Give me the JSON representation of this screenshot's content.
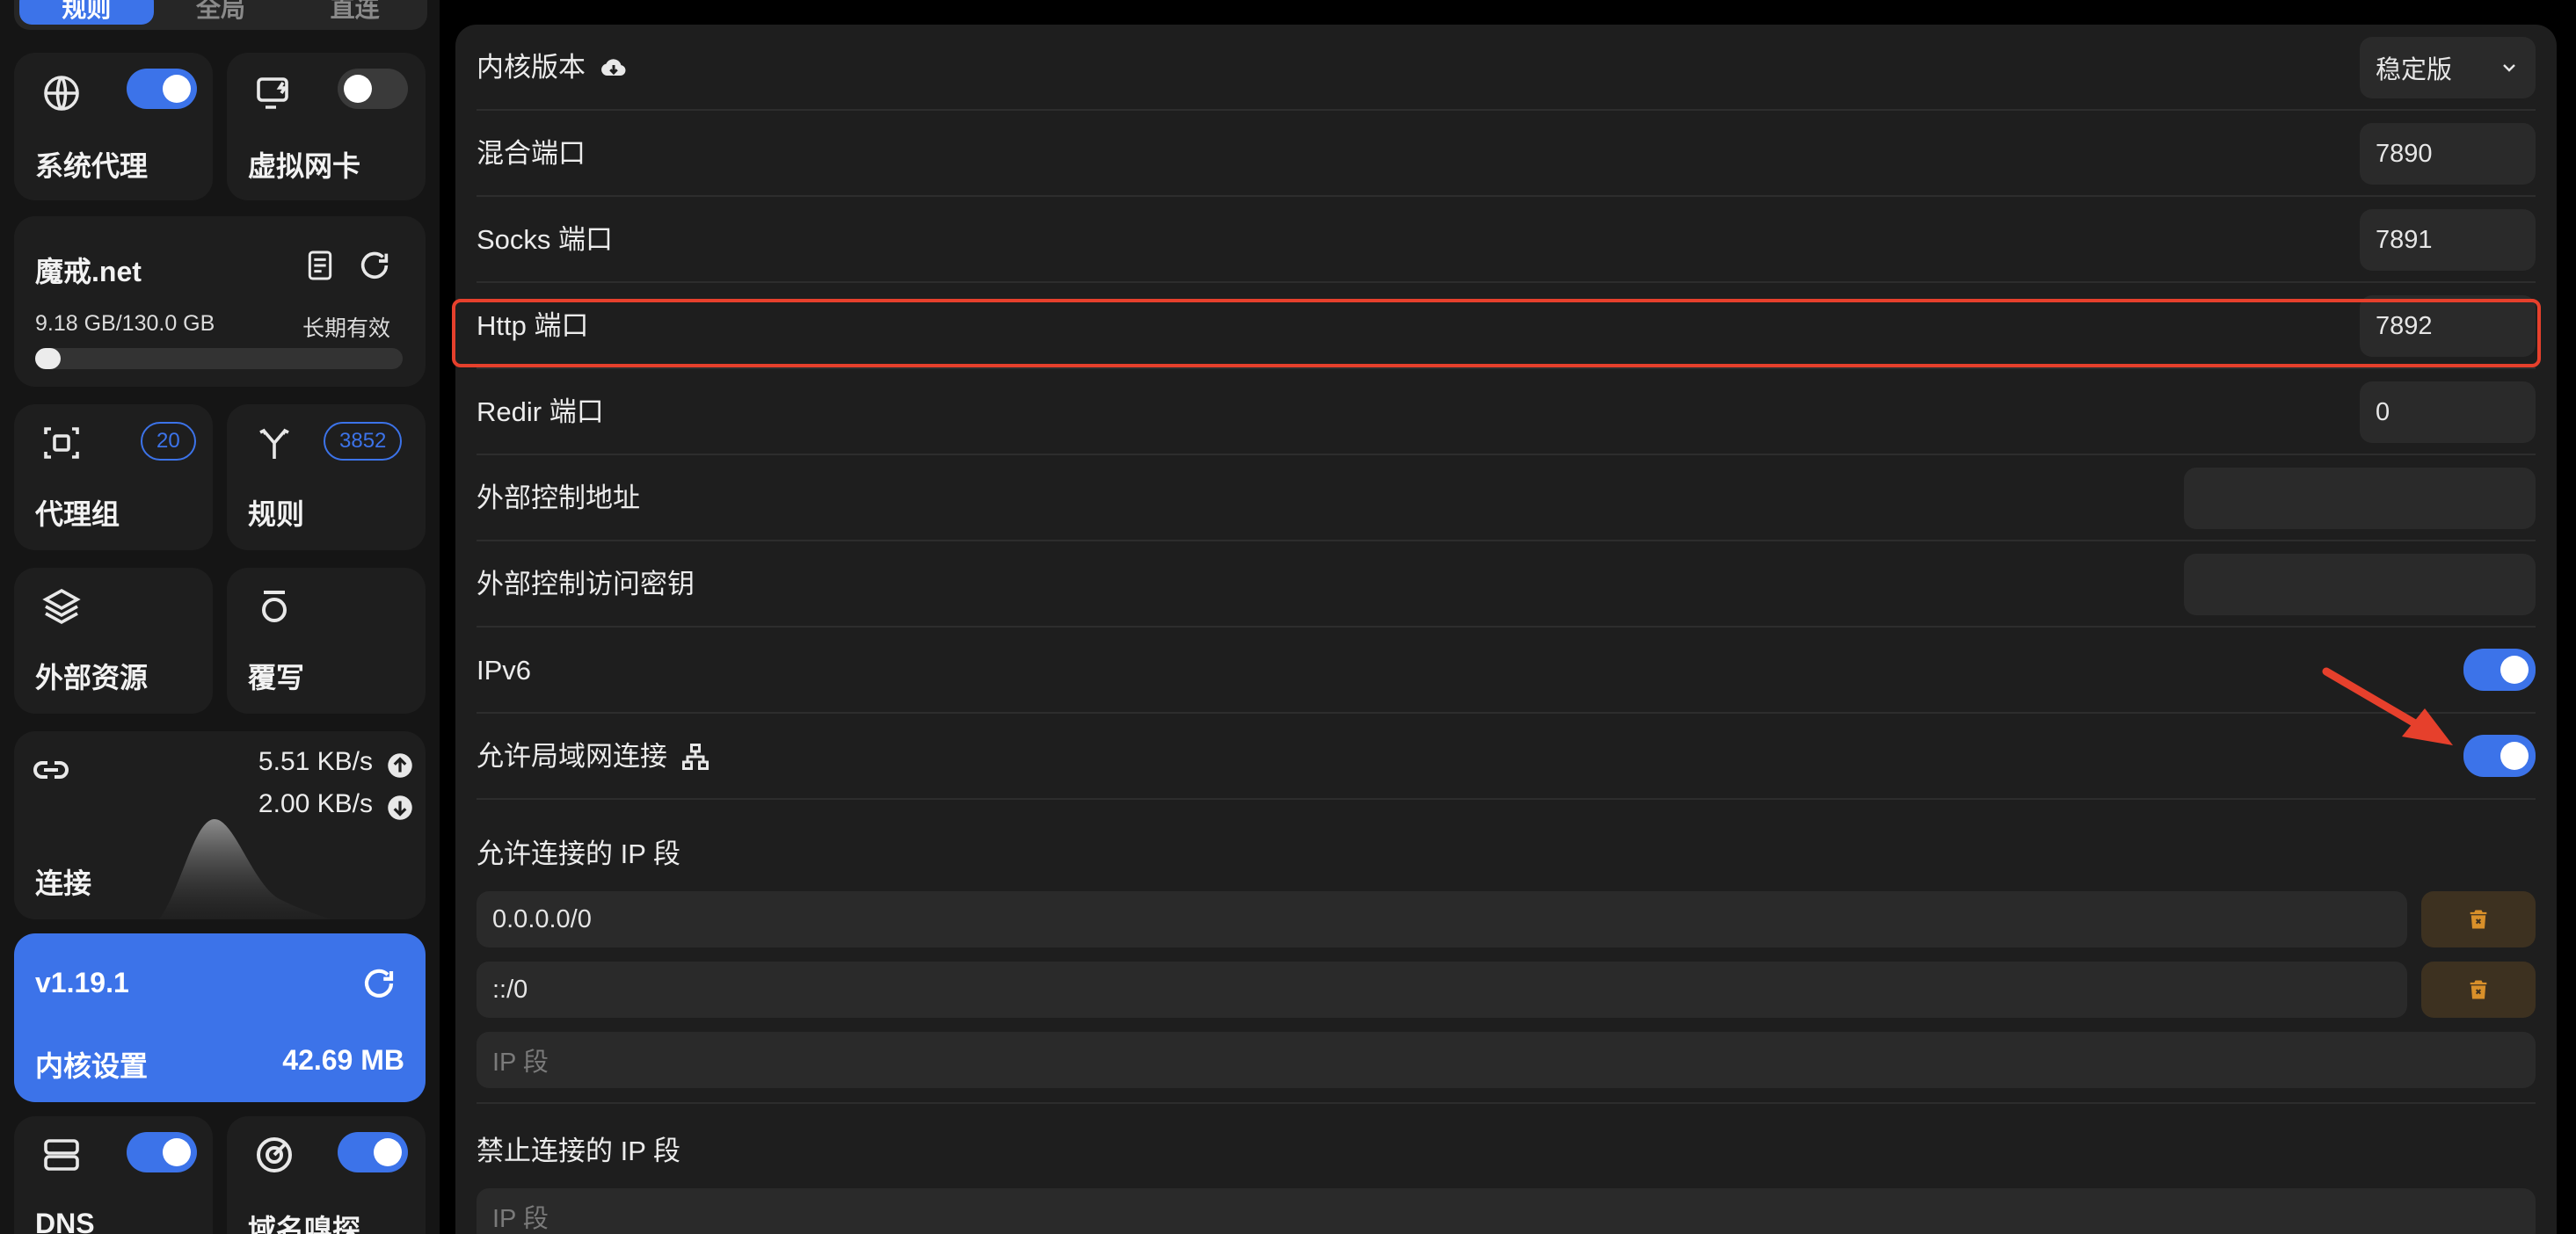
{
  "sidebar": {
    "mode_tabs": [
      "规则",
      "全局",
      "直连"
    ],
    "system_proxy": {
      "label": "系统代理",
      "enabled": true
    },
    "tun": {
      "label": "虚拟网卡",
      "enabled": false
    },
    "subscription": {
      "name": "魔戒.net",
      "usage": "9.18 GB/130.0 GB",
      "expiry": "长期有效",
      "progress": 0.07
    },
    "proxy_groups": {
      "label": "代理组",
      "count": "20"
    },
    "rules": {
      "label": "规则",
      "count": "3852"
    },
    "external_resources": {
      "label": "外部资源"
    },
    "override": {
      "label": "覆写"
    },
    "connections": {
      "label": "连接",
      "upload": "5.51 KB/s",
      "download": "2.00 KB/s"
    },
    "core": {
      "version": "v1.19.1",
      "label": "内核设置",
      "memory": "42.69 MB"
    },
    "dns": {
      "label": "DNS",
      "enabled": true
    },
    "sniff": {
      "label": "域名嗅探",
      "enabled": true
    }
  },
  "settings": {
    "core_version": {
      "label": "内核版本",
      "value": "稳定版"
    },
    "mixed_port": {
      "label": "混合端口",
      "value": "7890"
    },
    "socks_port": {
      "label": "Socks 端口",
      "value": "7891"
    },
    "http_port": {
      "label": "Http 端口",
      "value": "7892"
    },
    "redir_port": {
      "label": "Redir 端口",
      "value": "0"
    },
    "external_controller": {
      "label": "外部控制地址",
      "value": ""
    },
    "secret": {
      "label": "外部控制访问密钥",
      "value": ""
    },
    "ipv6": {
      "label": "IPv6",
      "enabled": true
    },
    "allow_lan": {
      "label": "允许局域网连接",
      "enabled": true
    },
    "allowed_ips": {
      "label": "允许连接的 IP 段",
      "items": [
        "0.0.0.0/0",
        "::/0"
      ],
      "placeholder": "IP 段"
    },
    "denied_ips": {
      "label": "禁止连接的 IP 段",
      "placeholder": "IP 段"
    }
  },
  "colors": {
    "accent": "#3c73e9",
    "highlight": "#e6402c",
    "delete_icon": "#d9902a"
  }
}
